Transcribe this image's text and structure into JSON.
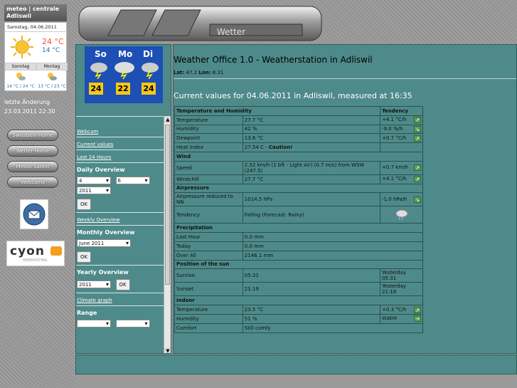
{
  "brand": {
    "line1": "meteo | centrale",
    "line2": "Adliswil"
  },
  "widget": {
    "date": "Samstag, 04.06.2011",
    "temp_high": "24 °C",
    "temp_low": "14 °C",
    "day1": "Sonntag",
    "day2": "Montag",
    "day1_range": "14 °C / 24 °C",
    "day2_range": "13 °C / 23 °C"
  },
  "lastchange": {
    "label": "letzte Änderung",
    "value": "23.03.2011 22:30"
  },
  "nav_buttons": [
    "Swissbelli-Home",
    "Wetter-Home",
    "Meteo-Satelit",
    "Webcams"
  ],
  "hosting": {
    "logo": "cyon",
    "sub": "WEBHOSTING"
  },
  "banner": {
    "title": "Wetter"
  },
  "forecast": {
    "days": [
      "So",
      "Mo",
      "Di"
    ],
    "temps": [
      "24",
      "22",
      "24"
    ]
  },
  "nav": {
    "webcam": "Webcam",
    "current": "Current values",
    "last24": "Last 24 Hours",
    "daily_title": "Daily Overview",
    "daily_day": "4",
    "daily_month": "6",
    "daily_year": "2011",
    "ok": "OK",
    "weekly": "Weekly Overview",
    "monthly_title": "Monthly Overview",
    "monthly_value": "June 2011",
    "yearly_title": "Yearly Overview",
    "yearly_value": "2011",
    "climate": "Climate graph",
    "range_title": "Range"
  },
  "main": {
    "title": "Weather Office 1.0 - Weatherstation in Adliswil",
    "lat_label": "Lat:",
    "lat": "47.2",
    "lon_label": "Lon:",
    "lon": "8.31",
    "current": "Current values for 04.06.2011 in Adliswil, measured at 16:35"
  },
  "table": {
    "temp_humidity_header": "Temperature and Humidity",
    "tendency_header": "Tendency",
    "temperature_label": "Temperature",
    "temperature_value": "27.7 °C",
    "temperature_tend": "+4.1 °C/h",
    "humidity_label": "Humidity",
    "humidity_value": "42 %",
    "humidity_tend": "-9.0 %/h",
    "dewpoint_label": "Dewpoint",
    "dewpoint_value": "13.6 °C",
    "dewpoint_tend": "+0.7 °C/h",
    "heatindex_label": "Heat Index",
    "heatindex_value": "27.54 C -",
    "heatindex_warn": "Caution!",
    "wind_header": "Wind",
    "speed_label": "Speed",
    "speed_value": "2.52 km/h (1 bft - Light Air) (0.7 m/s) from WSW (247.5)",
    "speed_tend": "+0.7 km/h",
    "windchill_label": "Windchill",
    "windchill_value": "27.7 °C",
    "windchill_tend": "+4.1 °C/h",
    "airpressure_header": "Airpressure",
    "ap_label": "Airpressure reduced to NN",
    "ap_value": "1014.5 hPa",
    "ap_tend": "-1.0 hPa/h",
    "tendency_label": "Tendency",
    "tendency_value": "Falling (Forecast: Rainy)",
    "precip_header": "Precipitation",
    "lasthour_label": "Last Hour",
    "lasthour_value": "0.0 mm",
    "today_label": "Today",
    "today_value": "0.0 mm",
    "overall_label": "Over All",
    "overall_value": "2146.1 mm",
    "sun_header": "Position of the sun",
    "sunrise_label": "Sunrise",
    "sunrise_value": "05:31",
    "sunrise_prev": "Yesterday 05:31",
    "sunset_label": "Sunset",
    "sunset_value": "21:19",
    "sunset_prev": "Yesterday 21:18",
    "indoor_header": "Indoor",
    "in_temp_label": "Temperature",
    "in_temp_value": "23.5 °C",
    "in_temp_tend": "+0.3 °C/h",
    "in_hum_label": "Humidity",
    "in_hum_value": "51 %",
    "in_hum_tend": "stable",
    "comfort_label": "Comfort",
    "comfort_value": "Still comfy"
  },
  "icons": [
    "sun-icon",
    "partly-cloudy-icon",
    "thunderstorm-icon",
    "mail-icon",
    "trend-arrow-icon",
    "rain-cloud-icon"
  ]
}
